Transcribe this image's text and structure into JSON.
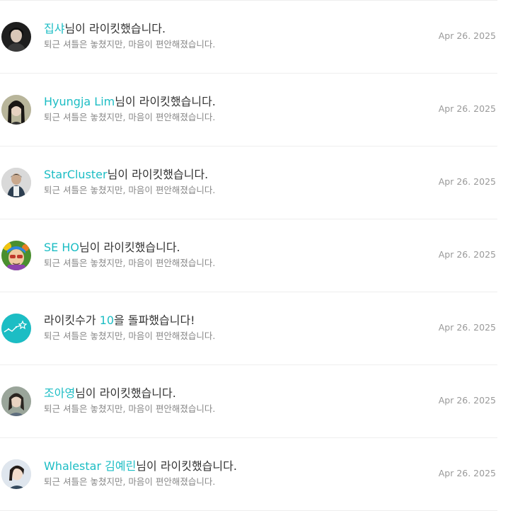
{
  "colors": {
    "accent": "#1cbdc4",
    "text": "#333333",
    "sub_text": "#888888",
    "date_text": "#999999",
    "divider": "#eeeeee"
  },
  "notifications": [
    {
      "name": "집샤",
      "action": "님이 라이킷했습니다.",
      "message": "퇴근 셔틀은 놓쳤지만, 마음이 편안해졌습니다.",
      "date": "Apr 26. 2025",
      "avatar": "user-photo-avatar"
    },
    {
      "name": "Hyungja Lim",
      "action": "님이 라이킷했습니다.",
      "message": "퇴근 셔틀은 놓쳤지만, 마음이 편안해졌습니다.",
      "date": "Apr 26. 2025",
      "avatar": "user-photo-avatar"
    },
    {
      "name": "StarCluster",
      "action": "님이 라이킷했습니다.",
      "message": "퇴근 셔틀은 놓쳤지만, 마음이 편안해졌습니다.",
      "date": "Apr 26. 2025",
      "avatar": "user-photo-avatar"
    },
    {
      "name": "SE HO",
      "action": "님이 라이킷했습니다.",
      "message": "퇴근 셔틀은 놓쳤지만, 마음이 편안해졌습니다.",
      "date": "Apr 26. 2025",
      "avatar": "user-illustration-avatar"
    },
    {
      "milestone_prefix": "라이킷수가 ",
      "milestone_count": "10",
      "milestone_suffix": "을 돌파했습니다!",
      "message": "퇴근 셔틀은 놓쳤지만, 마음이 편안해졌습니다.",
      "date": "Apr 26. 2025",
      "avatar": "milestone-star-icon"
    },
    {
      "name": "조아영",
      "action": "님이 라이킷했습니다.",
      "message": "퇴근 셔틀은 놓쳤지만, 마음이 편안해졌습니다.",
      "date": "Apr 26. 2025",
      "avatar": "user-photo-avatar"
    },
    {
      "name": "Whalestar 김예린",
      "action": "님이 라이킷했습니다.",
      "message": "퇴근 셔틀은 놓쳤지만, 마음이 편안해졌습니다.",
      "date": "Apr 26. 2025",
      "avatar": "user-photo-avatar"
    }
  ]
}
